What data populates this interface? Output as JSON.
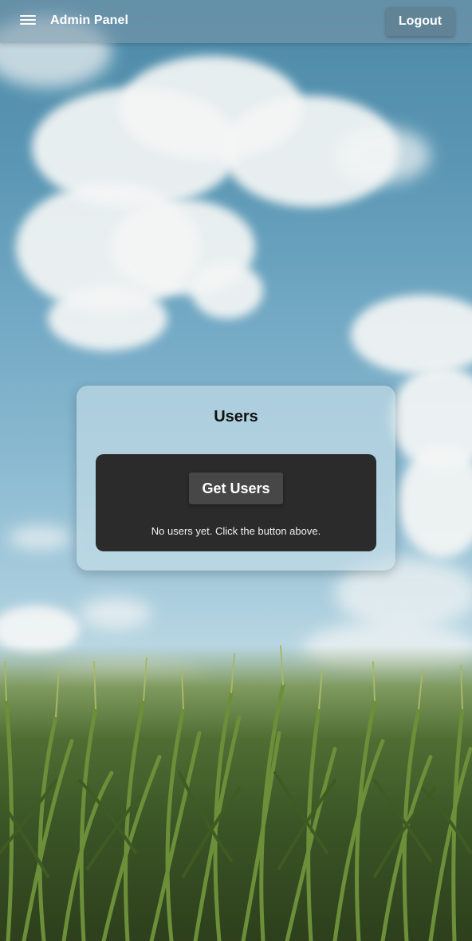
{
  "appbar": {
    "menu_icon": "hamburger-menu-icon",
    "title": "Admin Panel",
    "logout_label": "Logout"
  },
  "users_card": {
    "title": "Users",
    "get_users_label": "Get Users",
    "empty_message": "No users yet. Click the button above."
  },
  "colors": {
    "appbar_bg": "#7896a8",
    "panel_bg": "#2b2b2b",
    "button_bg": "#474747",
    "text_light": "#ffffff"
  }
}
